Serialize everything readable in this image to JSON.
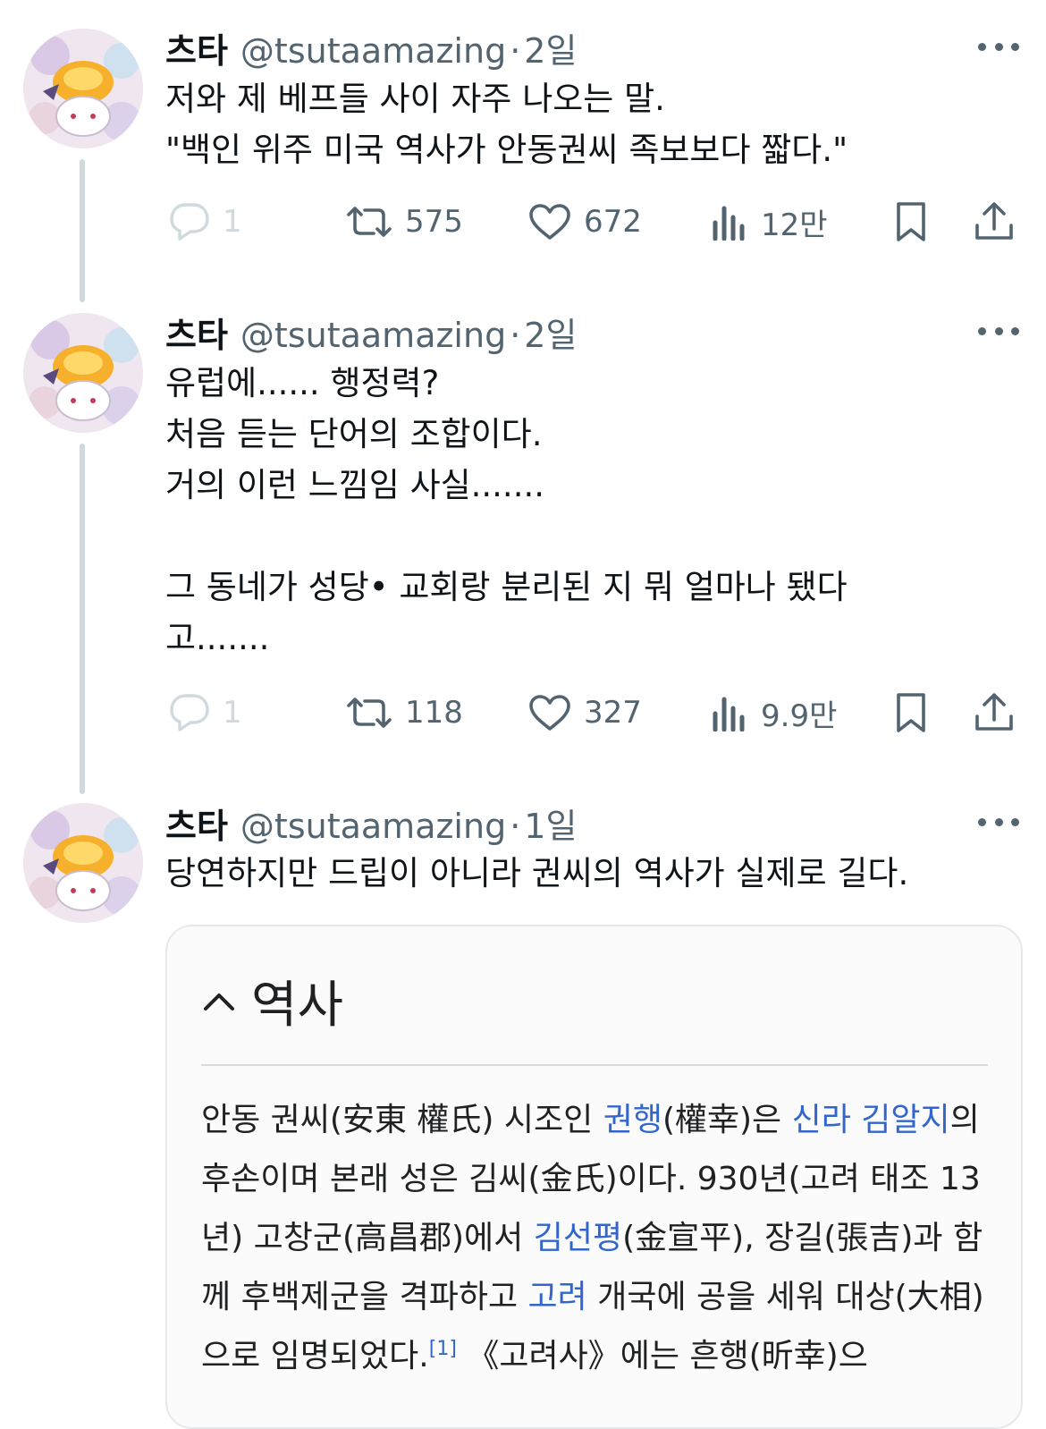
{
  "tweets": [
    {
      "name": "츠타",
      "handle": "@tsutaamazing",
      "separator": "·",
      "time": "2일",
      "text": "저와 제 베프들 사이 자주 나오는 말.\n\"백인 위주 미국 역사가 안동권씨 족보보다 짧다.\"",
      "replies": "1",
      "retweets": "575",
      "likes": "672",
      "views": "12만"
    },
    {
      "name": "츠타",
      "handle": "@tsutaamazing",
      "separator": "·",
      "time": "2일",
      "text": "유럽에...... 행정력?\n처음 듣는 단어의 조합이다.\n거의 이런 느낌임 사실.......\n\n그 동네가 성당• 교회랑 분리된 지 뭐 얼마나 됐다\n고.......",
      "replies": "1",
      "retweets": "118",
      "likes": "327",
      "views": "9.9만"
    },
    {
      "name": "츠타",
      "handle": "@tsutaamazing",
      "separator": "·",
      "time": "1일",
      "text": "당연하지만 드립이 아니라 권씨의 역사가 실제로 길다."
    }
  ],
  "card": {
    "title": "역사",
    "body": {
      "t1": "안동 권씨(安東 權氏) 시조인 ",
      "l1": "권행",
      "t2": "(權幸)은 ",
      "l2": "신라 김알지",
      "t3": "의 후손이며 본래 성은 김씨(金氏)이다. 930년(고려 태조 13년) 고창군(高昌郡)에서 ",
      "l3": "김선평",
      "t4": "(金宣平), 장길(張吉)과 함께 후백제군을 격파하고 ",
      "l4": "고려",
      "t5": " 개국에 공을 세워 대상(大相)으로 임명되었다.",
      "ref": "[1]",
      "t6": " 《고려사》에는 흔행(昕幸)으"
    }
  },
  "colors": {
    "text": "#0f1419",
    "secondary": "#536471",
    "thread_line": "#cfd9de",
    "link": "#3366cc"
  },
  "icons": [
    "reply-icon",
    "retweet-icon",
    "like-icon",
    "views-icon",
    "bookmark-icon",
    "share-icon",
    "more-icon",
    "chevron-up-icon"
  ]
}
